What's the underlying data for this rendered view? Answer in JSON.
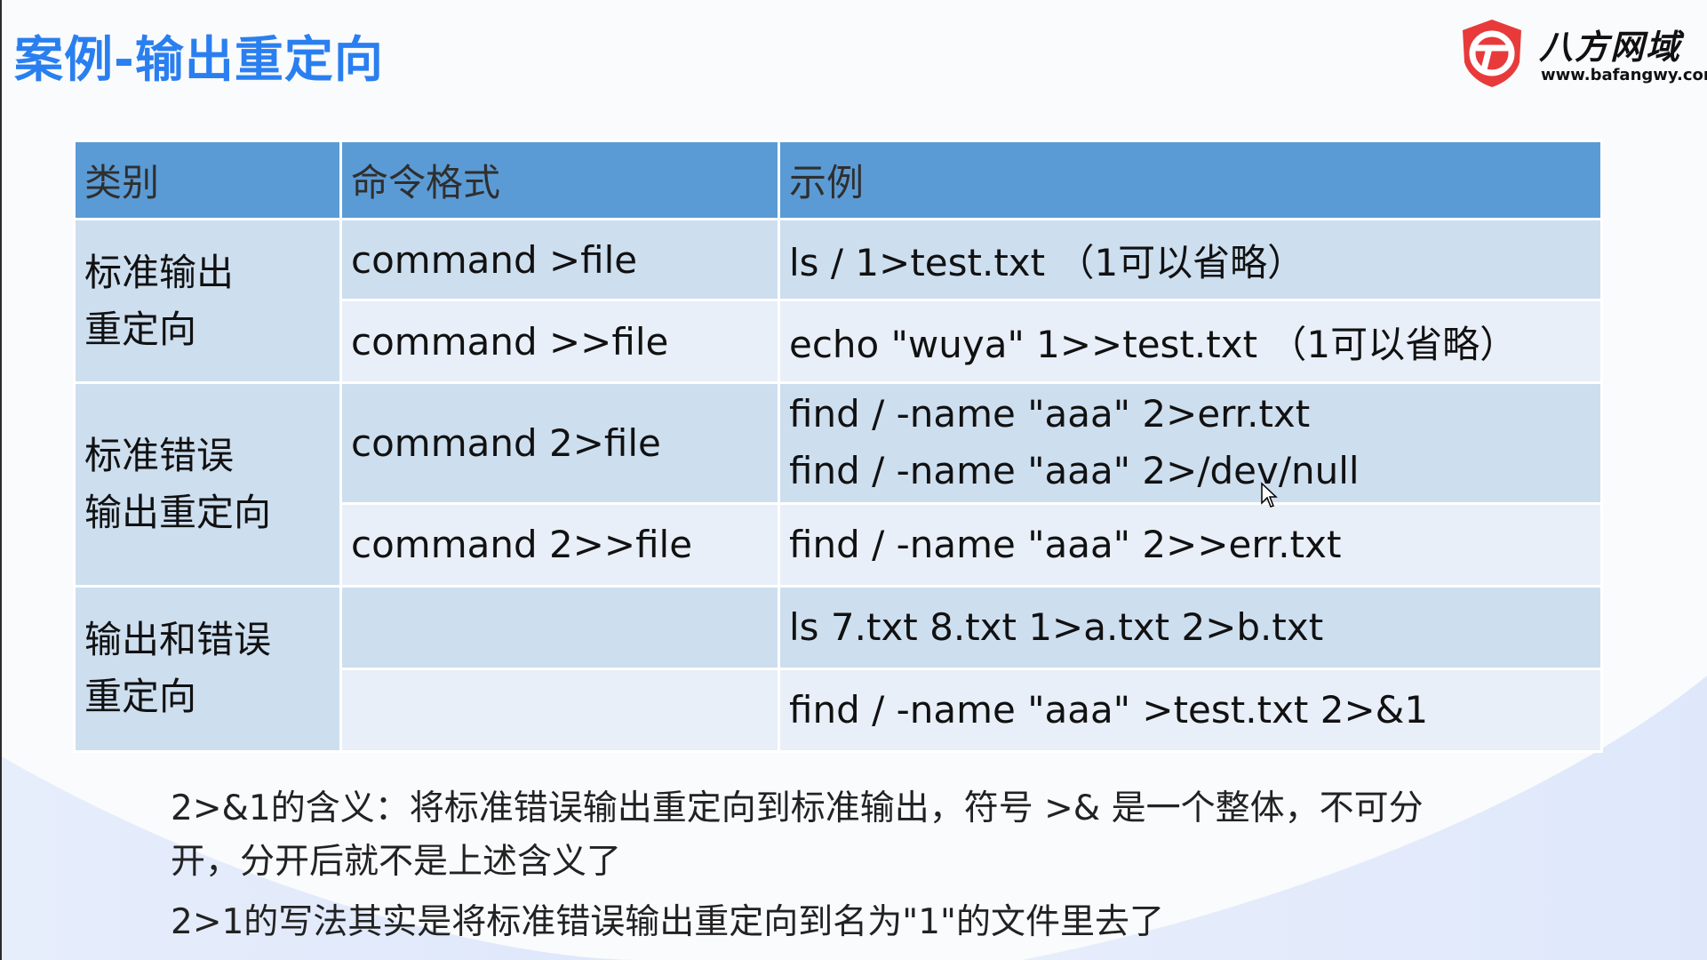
{
  "slide": {
    "title": "案例-输出重定向",
    "logo_name": "八方网域",
    "logo_url": "www.bafangwy.com",
    "accent_color": "#2a7ff0",
    "header_color": "#5b9bd5",
    "logo_color": "#e83a3a"
  },
  "table": {
    "headers": [
      "类别",
      "命令格式",
      "示例"
    ],
    "groups": [
      {
        "category_lines": [
          "标准输出",
          "重定向"
        ]
      },
      {
        "category_lines": [
          "标准错误",
          "输出重定向"
        ]
      },
      {
        "category_lines": [
          "输出和错误",
          "重定向"
        ]
      }
    ],
    "rows": [
      {
        "format": "command >file",
        "examples": [
          "ls / 1>test.txt （1可以省略）"
        ]
      },
      {
        "format": "command >>file",
        "examples": [
          "echo \"wuya\" 1>>test.txt （1可以省略）"
        ]
      },
      {
        "format": "command 2>file",
        "examples": [
          "find / -name \"aaa\"  2>err.txt",
          "find / -name \"aaa\" 2>/dev/null"
        ]
      },
      {
        "format": "command 2>>file",
        "examples": [
          "find / -name \"aaa\"  2>>err.txt"
        ]
      },
      {
        "format": "",
        "examples": [
          "ls 7.txt 8.txt 1>a.txt 2>b.txt"
        ]
      },
      {
        "format": "",
        "examples": [
          "find / -name \"aaa\" >test.txt 2>&1"
        ]
      }
    ]
  },
  "notes": [
    "2>&1的含义：将标准错误输出重定向到标准输出，符号 >& 是一个整体，不可分开，分开后就不是上述含义了",
    "2>1的写法其实是将标准错误输出重定向到名为\"1\"的文件里去了"
  ]
}
